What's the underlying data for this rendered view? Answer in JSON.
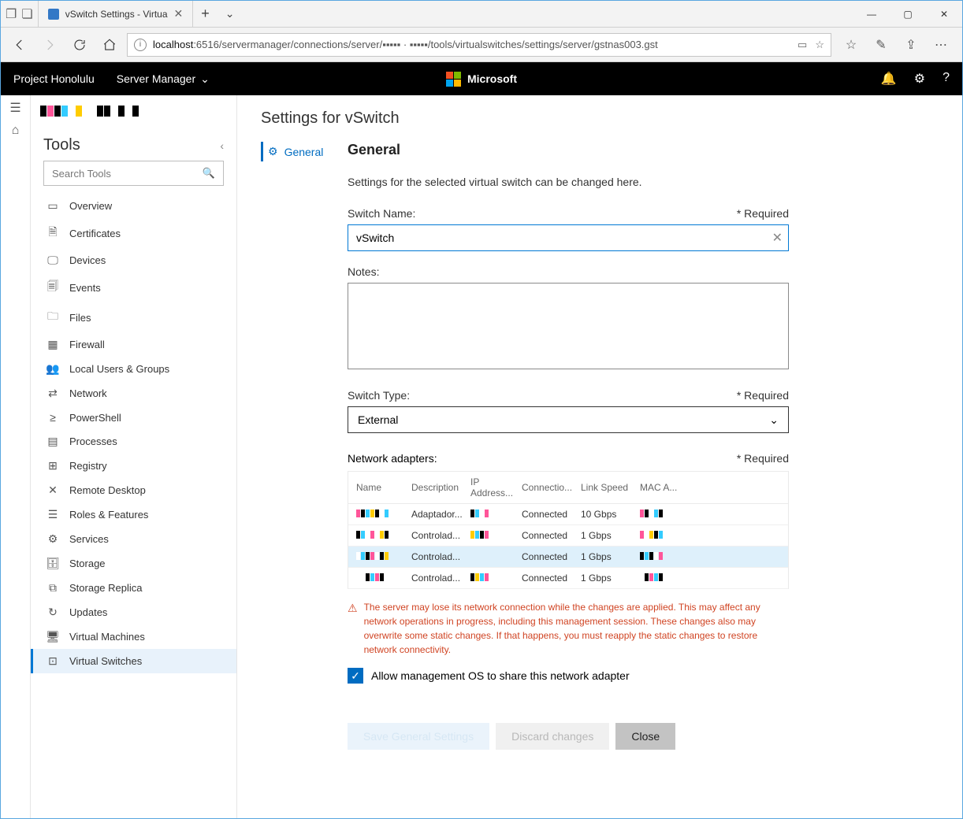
{
  "window": {
    "tab_title": "vSwitch Settings - Virtua",
    "minimize": "—",
    "maximize": "▢",
    "close": "✕"
  },
  "address": {
    "url_prefix": "localhost",
    "url_rest": ":6516/servermanager/connections/server/▪▪▪▪▪ · ▪▪▪▪▪/tools/virtualswitches/settings/server/gstnas003.gst"
  },
  "appbar": {
    "brand": "Project Honolulu",
    "menu": "Server Manager",
    "ms": "Microsoft"
  },
  "tools": {
    "title": "Tools",
    "search_placeholder": "Search Tools",
    "items": [
      {
        "icon": "▭",
        "label": "Overview"
      },
      {
        "icon": "🗎",
        "label": "Certificates"
      },
      {
        "icon": "🖵",
        "label": "Devices"
      },
      {
        "icon": "🗐",
        "label": "Events"
      },
      {
        "icon": "🗀",
        "label": "Files"
      },
      {
        "icon": "▦",
        "label": "Firewall"
      },
      {
        "icon": "👥",
        "label": "Local Users & Groups"
      },
      {
        "icon": "⇄",
        "label": "Network"
      },
      {
        "icon": "≥",
        "label": "PowerShell"
      },
      {
        "icon": "▤",
        "label": "Processes"
      },
      {
        "icon": "⊞",
        "label": "Registry"
      },
      {
        "icon": "✕",
        "label": "Remote Desktop"
      },
      {
        "icon": "☰",
        "label": "Roles & Features"
      },
      {
        "icon": "⚙",
        "label": "Services"
      },
      {
        "icon": "🗄",
        "label": "Storage"
      },
      {
        "icon": "⧉",
        "label": "Storage Replica"
      },
      {
        "icon": "↻",
        "label": "Updates"
      },
      {
        "icon": "🖥",
        "label": "Virtual Machines"
      },
      {
        "icon": "⊡",
        "label": "Virtual Switches"
      }
    ],
    "active_index": 18
  },
  "main": {
    "title": "Settings for vSwitch",
    "nav_general": "General",
    "heading": "General",
    "description": "Settings for the selected virtual switch can be changed here.",
    "switch_name_label": "Switch Name:",
    "required": "* Required",
    "switch_name_value": "vSwitch",
    "notes_label": "Notes:",
    "switch_type_label": "Switch Type:",
    "switch_type_value": "External",
    "adapters_label": "Network adapters:",
    "table": {
      "columns": [
        "Name",
        "Description",
        "IP Address...",
        "Connectio...",
        "Link Speed",
        "MAC A..."
      ],
      "rows": [
        {
          "desc": "Adaptador...",
          "conn": "Connected",
          "speed": "10 Gbps"
        },
        {
          "desc": "Controlad...",
          "conn": "Connected",
          "speed": "1 Gbps"
        },
        {
          "desc": "Controlad...",
          "conn": "Connected",
          "speed": "1 Gbps"
        },
        {
          "desc": "Controlad...",
          "conn": "Connected",
          "speed": "1 Gbps"
        }
      ],
      "selected_index": 2
    },
    "warning": "The server may lose its network connection while the changes are applied. This may affect any network operations in progress, including this management session. These changes also may overwrite some static changes. If that happens, you must reapply the static changes to restore network connectivity.",
    "allow_label": "Allow management OS to share this network adapter",
    "buttons": {
      "save": "Save General Settings",
      "discard": "Discard changes",
      "close": "Close"
    }
  }
}
